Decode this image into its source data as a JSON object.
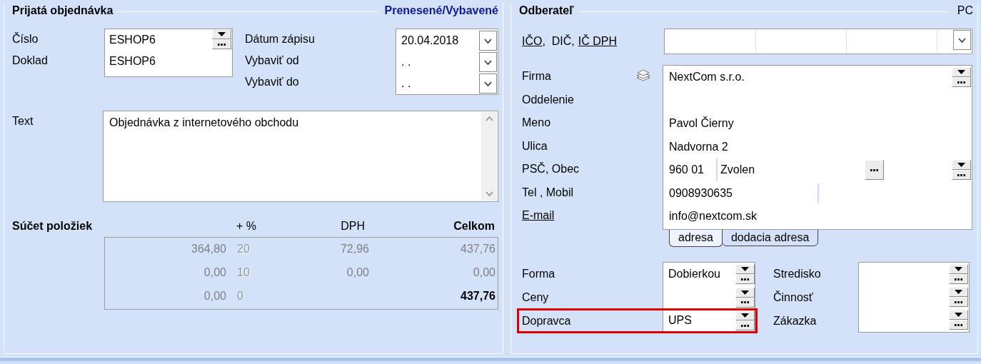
{
  "order": {
    "title": "Prijatá objednávka",
    "status": "Prenesené/Vybavené",
    "fields": [
      {
        "label": "Číslo",
        "value": "ESHOP6"
      },
      {
        "label": "Doklad",
        "value": "ESHOP6"
      }
    ],
    "dates": [
      {
        "label": "Dátum zápisu",
        "value": "20.04.2018"
      },
      {
        "label": "Vybaviť od",
        "value": ". ."
      },
      {
        "label": "Vybaviť do",
        "value": ". ."
      }
    ],
    "text": {
      "label": "Text",
      "value": "Objednávka z internetového obchodu"
    },
    "totals": {
      "title": "Súčet položiek",
      "columns": [
        {
          "label": "+ %",
          "bold": false
        },
        {
          "label": "DPH",
          "bold": false
        },
        {
          "label": "Celkom",
          "bold": true
        }
      ],
      "rows": [
        {
          "base": "364,80",
          "rate": "20",
          "vat": "72,96",
          "total": "437,76",
          "bold": false
        },
        {
          "base": "0,00",
          "rate": "10",
          "vat": "0,00",
          "total": "0,00",
          "bold": false
        },
        {
          "base": "0,00",
          "rate": "0",
          "total": "437,76",
          "bold": true
        }
      ]
    }
  },
  "customer": {
    "title": "Odberateľ",
    "code": "PC",
    "ids_label": [
      {
        "text": "IČO",
        "link": true
      },
      {
        "text": ",  DIČ,",
        "link": false
      },
      {
        "text": "IČ DPH",
        "link": true
      }
    ],
    "address": [
      {
        "label": "Firma",
        "kind": "text",
        "link": false,
        "value": "NextCom s.r.o."
      },
      {
        "label": "Oddelenie",
        "kind": "text",
        "link": false
      },
      {
        "label": "Meno",
        "kind": "text",
        "link": false,
        "value": "Pavol Čierny"
      },
      {
        "label": "Ulica",
        "kind": "text",
        "link": false,
        "value": "Nadvorna 2"
      },
      {
        "label": "PSČ, Obec",
        "kind": "city",
        "link": false,
        "value": "960 01",
        "value_2": "Zvolen"
      },
      {
        "label": "Tel , Mobil",
        "kind": "phone",
        "link": false,
        "value": "0908930635"
      },
      {
        "label": "E-mail",
        "kind": "text",
        "link": true,
        "value": "info@nextcom.sk"
      }
    ],
    "tabs": [
      {
        "label": "adresa",
        "selected": true
      },
      {
        "label": "dodacia adresa",
        "selected": false
      }
    ],
    "delivery": [
      {
        "label": "Forma",
        "value": "Dobierkou",
        "highlighted": false
      },
      {
        "label": "Ceny",
        "highlighted": false
      },
      {
        "label": "Dopravca",
        "value": "UPS",
        "highlighted": true
      }
    ],
    "assignment": [
      {
        "label": "Stredisko"
      },
      {
        "label": "Činnosť"
      },
      {
        "label": "Zákazka"
      }
    ]
  }
}
